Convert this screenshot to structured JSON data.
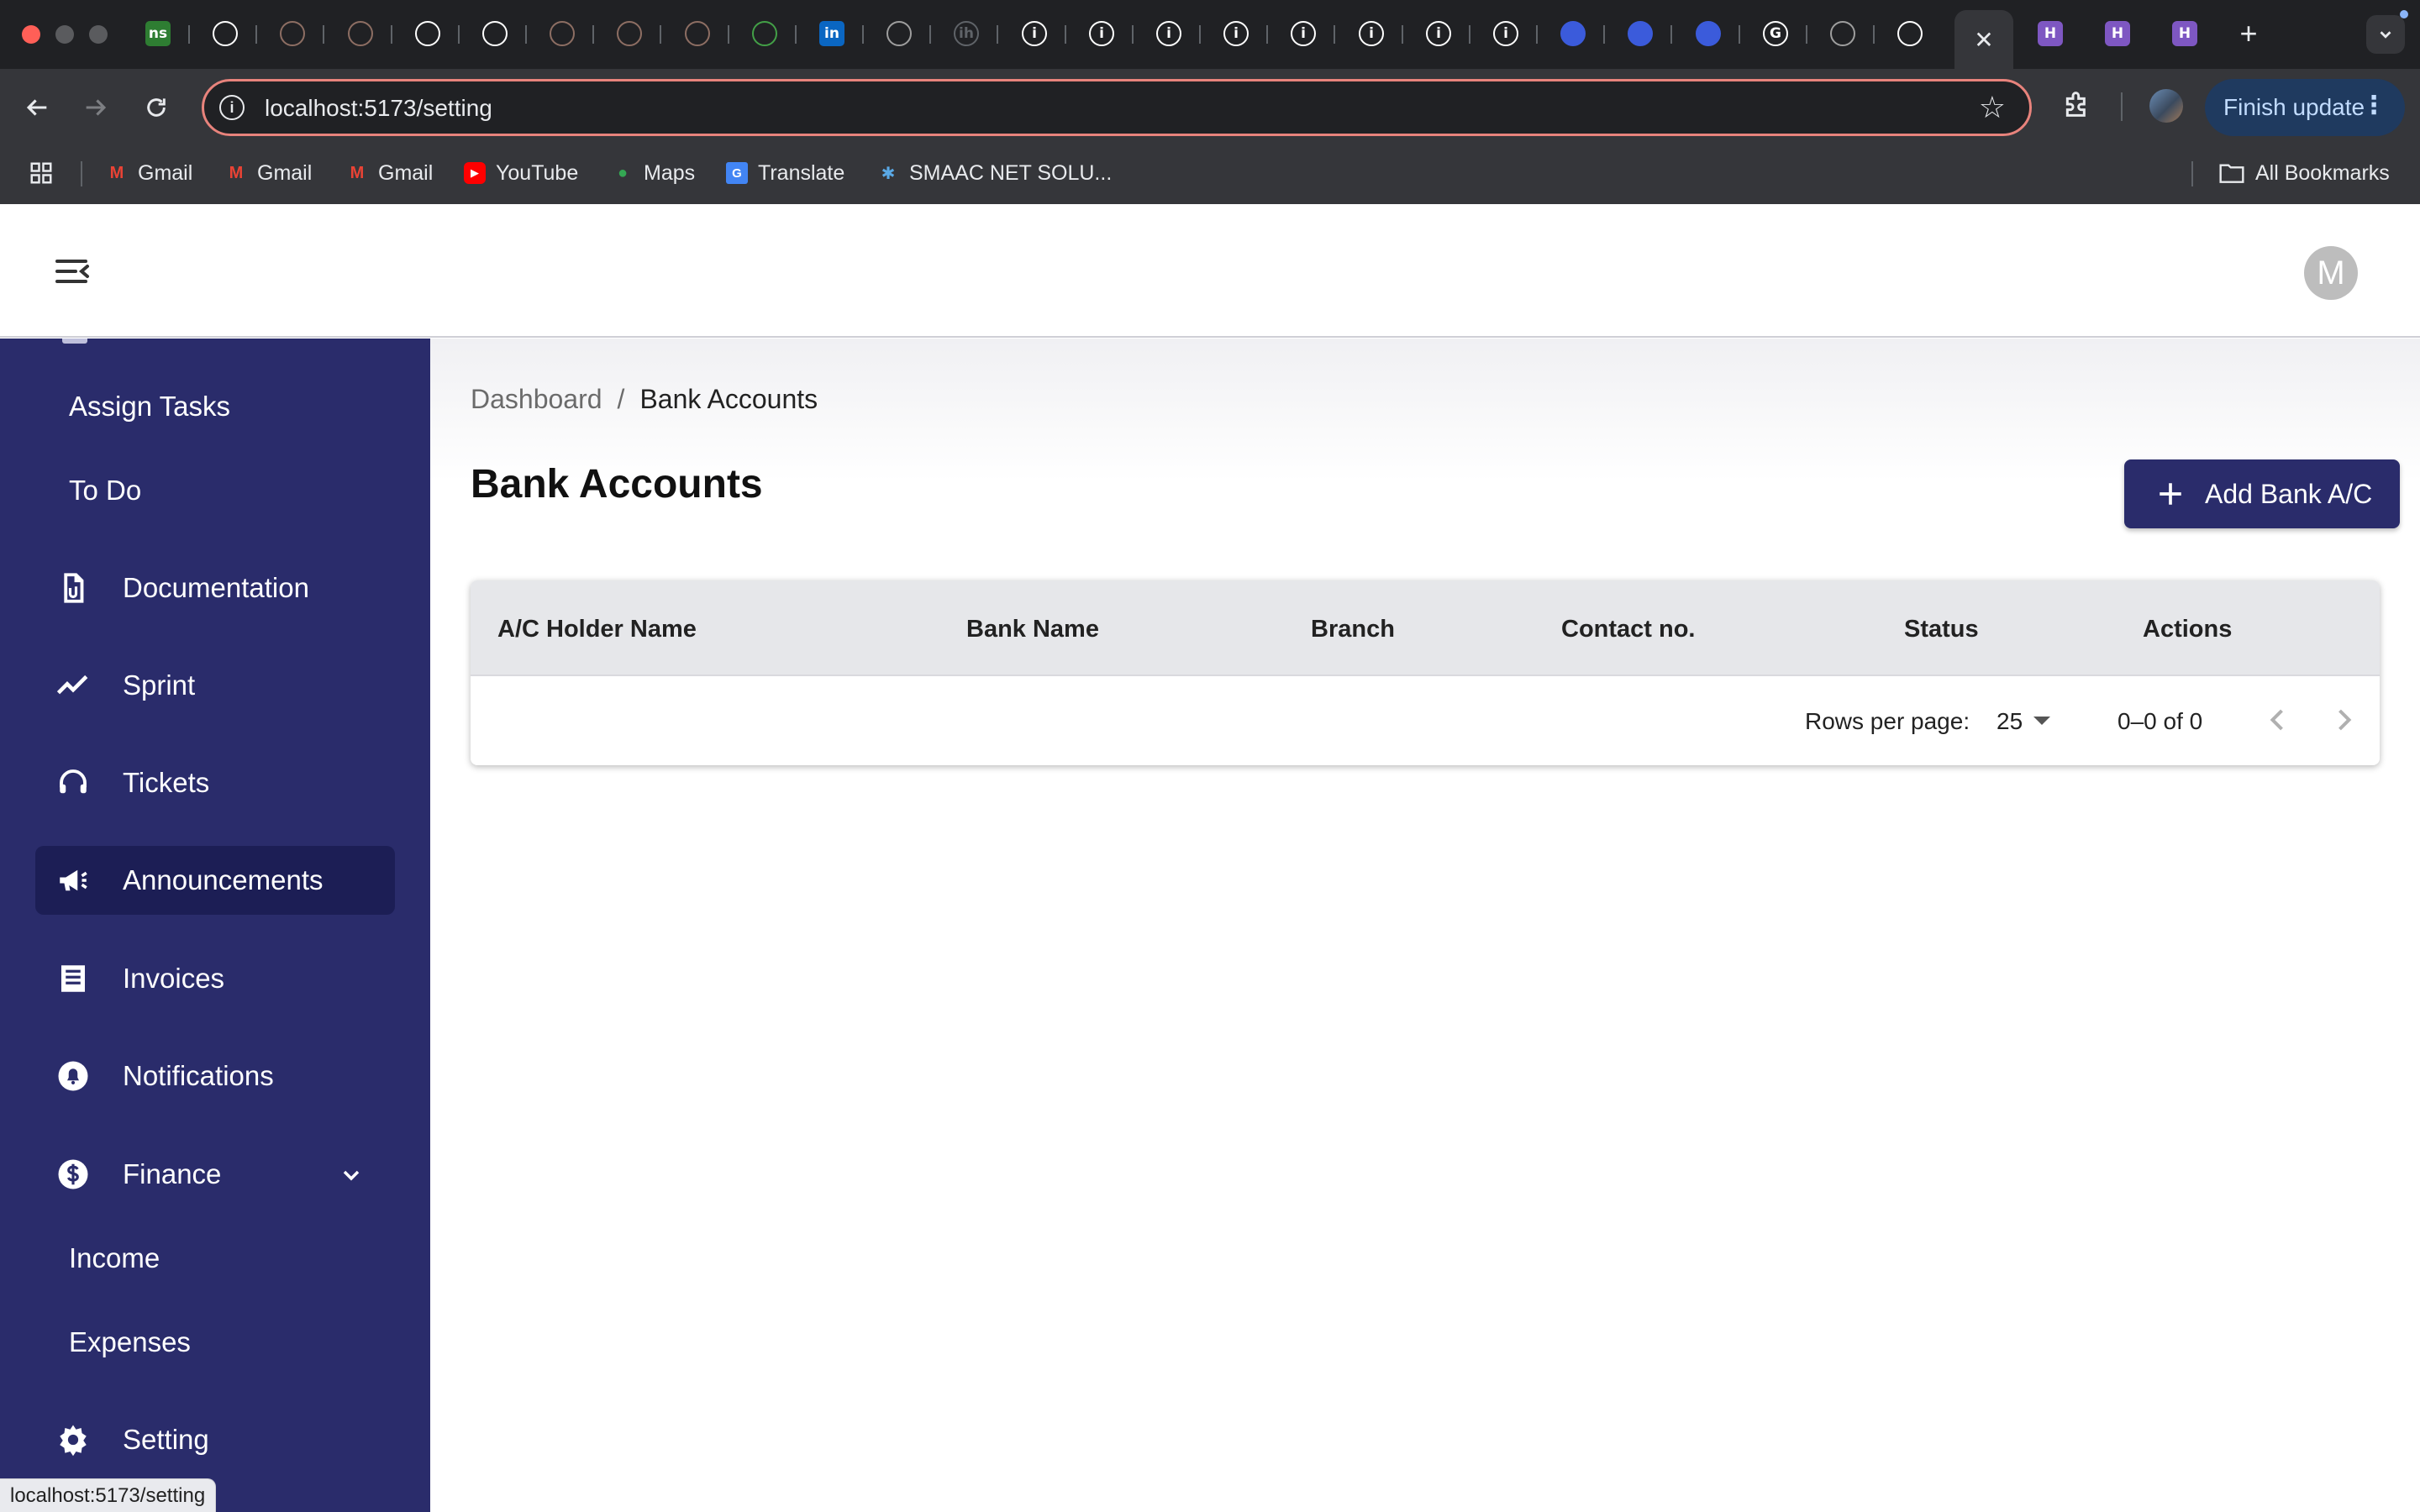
{
  "browser": {
    "active_tab_close": "✕",
    "new_tab": "+",
    "tab_favicons": [
      {
        "icon": "netsuite-icon",
        "text": "ns",
        "color": "#2e7d32"
      },
      {
        "icon": "openai-icon",
        "text": "",
        "color": "#ffffff"
      },
      {
        "icon": "seal-icon",
        "text": "",
        "color": "#8d6e63"
      },
      {
        "icon": "seal-icon",
        "text": "",
        "color": "#8d6e63"
      },
      {
        "icon": "github-icon",
        "text": "",
        "color": "#ffffff"
      },
      {
        "icon": "openai-icon",
        "text": "",
        "color": "#ffffff"
      },
      {
        "icon": "seal-icon",
        "text": "",
        "color": "#8d6e63"
      },
      {
        "icon": "seal-icon",
        "text": "",
        "color": "#8d6e63"
      },
      {
        "icon": "seal-icon",
        "text": "",
        "color": "#8d6e63"
      },
      {
        "icon": "node-icon",
        "text": "",
        "color": "#43a047"
      },
      {
        "icon": "linkedin-icon",
        "text": "in",
        "color": "#0a66c2"
      },
      {
        "icon": "globe-icon",
        "text": "",
        "color": "#9e9e9e"
      },
      {
        "icon": "ih-icon",
        "text": "ih",
        "color": "#5f6368"
      },
      {
        "icon": "info-icon",
        "text": "i",
        "color": "#ffffff"
      },
      {
        "icon": "info-icon",
        "text": "i",
        "color": "#ffffff"
      },
      {
        "icon": "info-icon",
        "text": "i",
        "color": "#ffffff"
      },
      {
        "icon": "info-icon",
        "text": "i",
        "color": "#ffffff"
      },
      {
        "icon": "info-icon",
        "text": "i",
        "color": "#ffffff"
      },
      {
        "icon": "info-icon",
        "text": "i",
        "color": "#ffffff"
      },
      {
        "icon": "info-icon",
        "text": "i",
        "color": "#ffffff"
      },
      {
        "icon": "info-icon",
        "text": "i",
        "color": "#ffffff"
      },
      {
        "icon": "kotlin-icon",
        "text": "",
        "color": "#3b5bdb"
      },
      {
        "icon": "kotlin-icon",
        "text": "",
        "color": "#3b5bdb"
      },
      {
        "icon": "kotlin-icon",
        "text": "",
        "color": "#3b5bdb"
      },
      {
        "icon": "google-icon",
        "text": "G",
        "color": "#ffffff"
      },
      {
        "icon": "globe-icon",
        "text": "",
        "color": "#9e9e9e"
      },
      {
        "icon": "github-icon",
        "text": "",
        "color": "#ffffff"
      }
    ],
    "trailing_favicons": [
      {
        "icon": "h-app-icon",
        "text": "H",
        "color": "#7e57c2"
      },
      {
        "icon": "h-app-icon",
        "text": "H",
        "color": "#7e57c2"
      },
      {
        "icon": "h-app-icon",
        "text": "H",
        "color": "#7e57c2"
      }
    ],
    "url": "localhost:5173/setting",
    "finish_update": "Finish update",
    "bookmarks": [
      {
        "label": "Gmail",
        "icon": "gmail-icon"
      },
      {
        "label": "Gmail",
        "icon": "gmail-icon"
      },
      {
        "label": "Gmail",
        "icon": "gmail-icon"
      },
      {
        "label": "YouTube",
        "icon": "youtube-icon"
      },
      {
        "label": "Maps",
        "icon": "maps-icon"
      },
      {
        "label": "Translate",
        "icon": "translate-icon"
      },
      {
        "label": "SMAAC NET SOLU...",
        "icon": "smaac-icon"
      }
    ],
    "all_bookmarks": "All Bookmarks",
    "status_url": "localhost:5173/setting"
  },
  "app": {
    "avatar_initial": "M",
    "sidebar": {
      "items": [
        {
          "label": "Assign Tasks",
          "type": "sub"
        },
        {
          "label": "To Do",
          "type": "sub"
        },
        {
          "label": "Documentation",
          "type": "main",
          "icon": "document-icon"
        },
        {
          "label": "Sprint",
          "type": "main",
          "icon": "trend-icon"
        },
        {
          "label": "Tickets",
          "type": "main",
          "icon": "headset-icon"
        },
        {
          "label": "Announcements",
          "type": "main",
          "icon": "megaphone-icon",
          "active": true
        },
        {
          "label": "Invoices",
          "type": "main",
          "icon": "receipt-icon"
        },
        {
          "label": "Notifications",
          "type": "main",
          "icon": "bell-icon"
        },
        {
          "label": "Finance",
          "type": "main",
          "icon": "dollar-icon",
          "expanded": true
        },
        {
          "label": "Income",
          "type": "sub"
        },
        {
          "label": "Expenses",
          "type": "sub"
        },
        {
          "label": "Setting",
          "type": "main",
          "icon": "gear-icon"
        }
      ]
    },
    "breadcrumb": {
      "root": "Dashboard",
      "separator": "/",
      "current": "Bank Accounts"
    },
    "page_title": "Bank Accounts",
    "add_button": "Add Bank A/C",
    "table": {
      "columns": [
        "A/C Holder Name",
        "Bank Name",
        "Branch",
        "Contact no.",
        "Status",
        "Actions"
      ],
      "rows": [],
      "rows_per_page_label": "Rows per page:",
      "rows_per_page": "25",
      "range": "0–0 of 0"
    },
    "colors": {
      "sidebar": "#2a2c6b",
      "sidebar_active": "#1c1e55",
      "primary_button": "#2a2c6b"
    }
  }
}
